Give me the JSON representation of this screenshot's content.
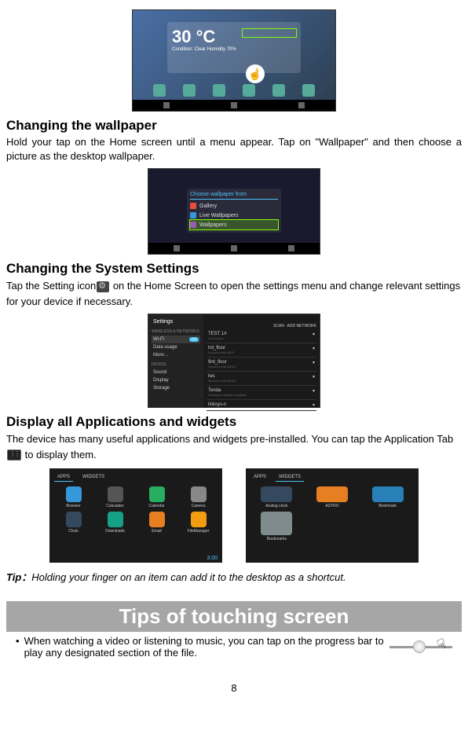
{
  "sections": {
    "wallpaper": {
      "heading": "Changing the wallpaper",
      "text": "Hold your tap on the Home screen until a menu appear. Tap on \"Wallpaper\" and then choose a picture as the desktop wallpaper."
    },
    "settings": {
      "heading": "Changing the System Settings",
      "text_before": "Tap the Setting icon",
      "text_after": " on the Home Screen to open the settings menu and change relevant settings for your device if necessary."
    },
    "apps": {
      "heading": "Display all Applications and widgets",
      "text_before": "The device has many useful applications and widgets pre-installed. You can tap the Application Tab ",
      "text_after": " to display them."
    },
    "tip": {
      "label": "Tip：",
      "text": "Holding your finger on an item can add it to the desktop as a shortcut."
    },
    "banner": "Tips of touching screen",
    "bullet": {
      "marker": "•",
      "text": "When watching a video or listening to music, you can tap on the progress bar to play any designated section of the file."
    }
  },
  "home_widget": {
    "temp": "30 °C",
    "condition": "Condition: Clear  Humidity  70%"
  },
  "wallpaper_dialog": {
    "title": "Choose wallpaper from",
    "items": [
      "Gallery",
      "Live Wallpapers",
      "Wallpapers"
    ]
  },
  "settings_screen": {
    "title": "Settings",
    "scan": "SCAN",
    "add": "ADD NETWORK",
    "section1": "WIRELESS & NETWORKS",
    "section2": "DEVICE",
    "sidebar": [
      {
        "label": "Wi-Fi",
        "toggle": "ON",
        "active": true
      },
      {
        "label": "Data usage"
      },
      {
        "label": "More…"
      },
      {
        "label": "Sound"
      },
      {
        "label": "Display"
      },
      {
        "label": "Storage"
      }
    ],
    "networks": [
      {
        "name": "TEST 1#",
        "sub": "Connected"
      },
      {
        "name": "trd_floor",
        "sub": "Secured with WEP"
      },
      {
        "name": "9rd_floor",
        "sub": "Secured with WPA2"
      },
      {
        "name": "lws",
        "sub": "Secured with WPA2"
      },
      {
        "name": "Tenda",
        "sub": "Protected network available"
      },
      {
        "name": "linksys-n",
        "sub": ""
      }
    ]
  },
  "apps_screen": {
    "tab1": "APPS",
    "tab2": "WIDGETS",
    "time": "3:00",
    "left_apps": [
      "Browser",
      "Calculator",
      "Calendar",
      "Camera",
      "Clock",
      "Downloads",
      "Email",
      "FileManager"
    ],
    "right_apps": [
      "Analog clock",
      "ASTRO",
      "Bookmark",
      "Bookmarks",
      "",
      "",
      "",
      ""
    ]
  },
  "page_number": "8"
}
